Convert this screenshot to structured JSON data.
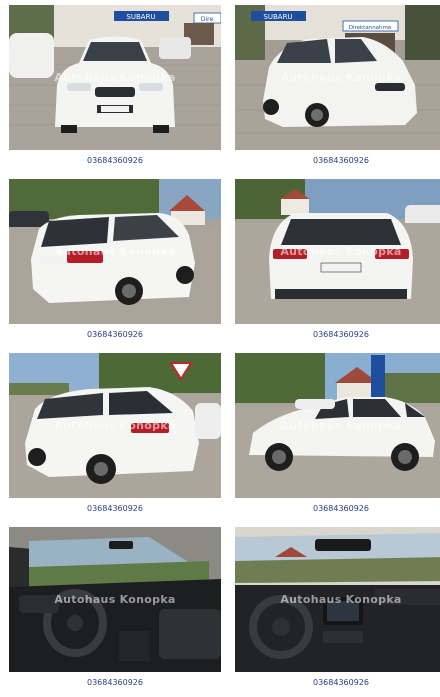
{
  "watermark": "Autohaus Konopka",
  "photos": [
    {
      "caption": "03684360926",
      "signs": [
        "SUBARU",
        "Dire"
      ]
    },
    {
      "caption": "03684360926",
      "signs": [
        "SUBARU",
        "Direktannahme"
      ]
    },
    {
      "caption": "03684360926"
    },
    {
      "caption": "03684360926"
    },
    {
      "caption": "03684360926"
    },
    {
      "caption": "03684360926"
    },
    {
      "caption": "03684360926"
    },
    {
      "caption": "03684360926"
    }
  ]
}
